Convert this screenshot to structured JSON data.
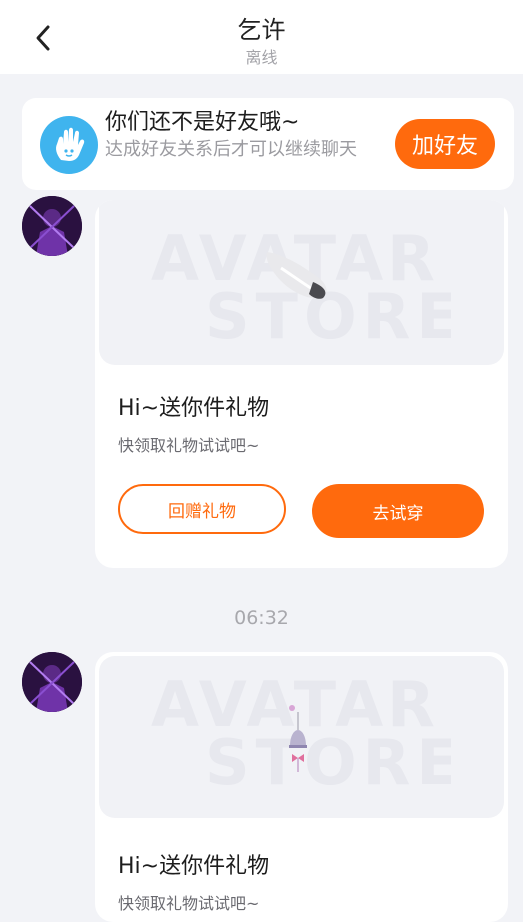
{
  "header": {
    "title": "乞许",
    "status": "离线"
  },
  "friend_banner": {
    "title": "你们还不是好友哦~",
    "description": "达成好友关系后才可以继续聊天",
    "add_button": "加好友"
  },
  "messages": [
    {
      "watermark_line1": "AVATAR",
      "watermark_line2": "STORE",
      "gift_title": "Hi~送你件礼物",
      "gift_desc": "快领取礼物试试吧~",
      "return_gift_label": "回赠礼物",
      "try_on_label": "去试穿"
    },
    {
      "watermark_line1": "AVATAR",
      "watermark_line2": "STORE",
      "gift_title": "Hi~送你件礼物",
      "gift_desc": "快领取礼物试试吧~"
    }
  ],
  "timestamp": "06:32",
  "colors": {
    "accent": "#ff6a0d",
    "banner_icon": "#3fb4ee",
    "page_bg": "#f2f3f7"
  },
  "icons": {
    "back": "chevron-left-icon",
    "banner": "hand-wave-icon"
  }
}
